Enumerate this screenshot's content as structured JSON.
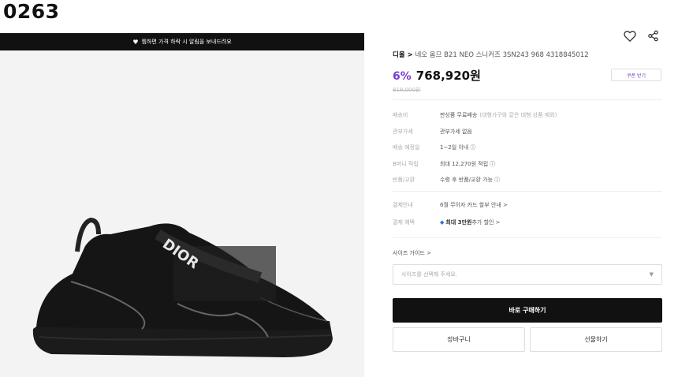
{
  "page_id": "0263",
  "alert_bar": {
    "text": "찜하면 가격 하락 시 알림을 보내드려요"
  },
  "product": {
    "brand": "디올",
    "title": "네오 옴므 B21 NEO 스니커즈 3SN243 968 4318845012",
    "discount": "6%",
    "price": "768,920원",
    "original_price": "818,000원",
    "coupon_label": "쿠폰 받기"
  },
  "info": [
    {
      "label": "배송비",
      "value": "판상품 무료배송",
      "note": "(대형가구와 같은 대형 상품 제외)"
    },
    {
      "label": "관부가세",
      "value": "관부가세 없음",
      "note": ""
    },
    {
      "label": "배송 예정일",
      "value": "1~2일 이내 ⓘ",
      "note": ""
    },
    {
      "label": "B머니 적립",
      "value": "최대 12,270원 적립 ⓘ",
      "note": ""
    },
    {
      "label": "반품/교환",
      "value": "수령 후 반품/교환 가능 ⓘ",
      "note": ""
    }
  ],
  "payment": [
    {
      "label": "결제안내",
      "value": "6월 무이자 카드 할부 안내 >"
    },
    {
      "label": "결제 혜택",
      "bold": "최대 3만원",
      "value": " 추가 할인 >"
    }
  ],
  "size_guide": "사이즈 가이드 >",
  "size_select": {
    "placeholder": "사이즈를 선택해 주세요."
  },
  "buttons": {
    "buy": "바로 구매하기",
    "cart": "장바구니",
    "gift": "선물하기"
  },
  "icons": [
    "heart-icon",
    "share-icon",
    "chevron-down-icon"
  ]
}
